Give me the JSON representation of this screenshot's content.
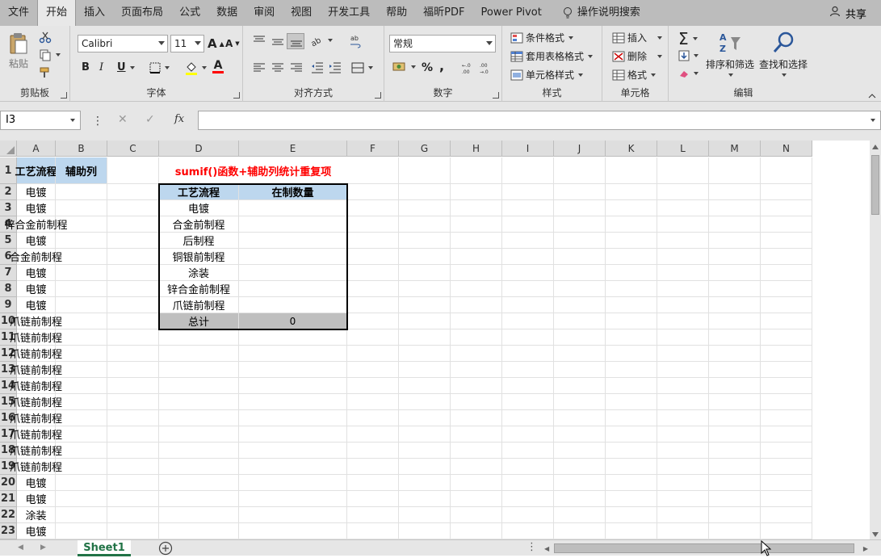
{
  "menubar": {
    "items": [
      "文件",
      "开始",
      "插入",
      "页面布局",
      "公式",
      "数据",
      "审阅",
      "视图",
      "开发工具",
      "帮助",
      "福昕PDF",
      "Power Pivot"
    ],
    "active_index": 1,
    "tell_me": "操作说明搜索",
    "share": "共享"
  },
  "ribbon": {
    "clipboard": {
      "label": "剪贴板",
      "paste": "粘贴"
    },
    "font": {
      "label": "字体",
      "name": "Calibri",
      "size": "11",
      "bold": "B",
      "italic": "I",
      "underline": "U",
      "grow": "A",
      "shrink": "A",
      "font_color": "A"
    },
    "alignment": {
      "label": "对齐方式"
    },
    "number": {
      "label": "数字",
      "format": "常规",
      "percent": "%",
      "comma": ","
    },
    "styles": {
      "label": "样式",
      "conditional": "条件格式",
      "table": "套用表格格式",
      "cell": "单元格样式"
    },
    "cells": {
      "label": "单元格",
      "insert": "插入",
      "delete": "删除",
      "format": "格式"
    },
    "editing": {
      "label": "编辑",
      "sort": "排序和筛选",
      "find": "查找和选择"
    }
  },
  "formula_bar": {
    "name_box": "I3",
    "fx": "fx",
    "value": ""
  },
  "columns": [
    "A",
    "B",
    "C",
    "D",
    "E",
    "F",
    "G",
    "H",
    "I",
    "J",
    "K",
    "L",
    "M",
    "N"
  ],
  "rows": [
    "1",
    "2",
    "3",
    "4",
    "5",
    "6",
    "7",
    "8",
    "9",
    "10",
    "11",
    "12",
    "13",
    "14",
    "15",
    "16",
    "17",
    "18",
    "19",
    "20",
    "21",
    "22",
    "23"
  ],
  "sheet": {
    "A_header": "工艺流程",
    "B_header": "辅助列",
    "A_values": [
      "电镀",
      "电镀",
      "锌合金前制程",
      "电镀",
      "合金前制程",
      "电镀",
      "电镀",
      "电镀",
      "爪链前制程",
      "爪链前制程",
      "爪链前制程",
      "爪链前制程",
      "爪链前制程",
      "爪链前制程",
      "爪链前制程",
      "爪链前制程",
      "爪链前制程",
      "爪链前制程",
      "电镀",
      "电镀",
      "涂装",
      "电镀"
    ],
    "title": "sumif()函数+辅助列统计重复项",
    "summary_headers": [
      "工艺流程",
      "在制数量"
    ],
    "summary_items": [
      "电镀",
      "合金前制程",
      "后制程",
      "铜银前制程",
      "涂装",
      "锌合金前制程",
      "爪链前制程"
    ],
    "total_label": "总计",
    "total_value": "0"
  },
  "tabs": {
    "sheet_name": "Sheet1"
  },
  "colors": {
    "header_fill": "#bdd7ee",
    "total_fill": "#bfbfbf",
    "title_red": "#ff0000",
    "accent_green": "#217346"
  }
}
